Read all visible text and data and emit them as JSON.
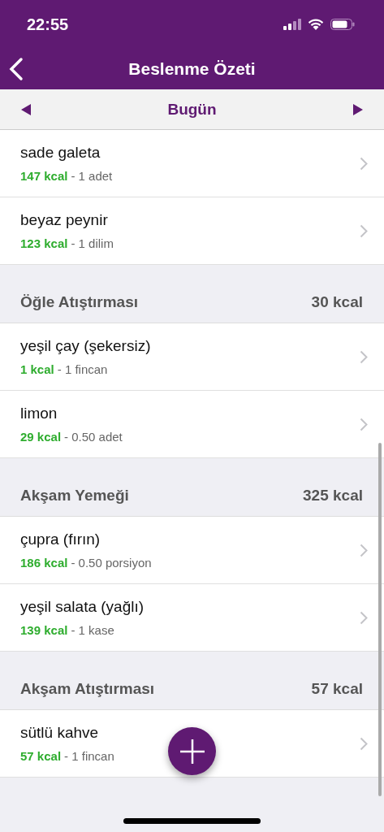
{
  "status_bar": {
    "time": "22:55"
  },
  "nav": {
    "title": "Beslenme Özeti"
  },
  "date_bar": {
    "label": "Bugün"
  },
  "sections": [
    {
      "items": [
        {
          "name": "sade galeta",
          "kcal": "147 kcal",
          "amount": "- 1 adet"
        },
        {
          "name": "beyaz peynir",
          "kcal": "123 kcal",
          "amount": "- 1 dilim"
        }
      ]
    },
    {
      "title": "Öğle Atıştırması",
      "total": "30 kcal",
      "items": [
        {
          "name": "yeşil çay (şekersiz)",
          "kcal": "1 kcal",
          "amount": "- 1 fincan"
        },
        {
          "name": "limon",
          "kcal": "29 kcal",
          "amount": "- 0.50 adet"
        }
      ]
    },
    {
      "title": "Akşam Yemeği",
      "total": "325 kcal",
      "items": [
        {
          "name": "çupra (fırın)",
          "kcal": "186 kcal",
          "amount": "- 0.50 porsiyon"
        },
        {
          "name": "yeşil salata (yağlı)",
          "kcal": "139 kcal",
          "amount": "- 1 kase"
        }
      ]
    },
    {
      "title": "Akşam Atıştırması",
      "total": "57 kcal",
      "items": [
        {
          "name": "sütlü kahve",
          "kcal": "57 kcal",
          "amount": "- 1 fincan"
        }
      ]
    }
  ]
}
